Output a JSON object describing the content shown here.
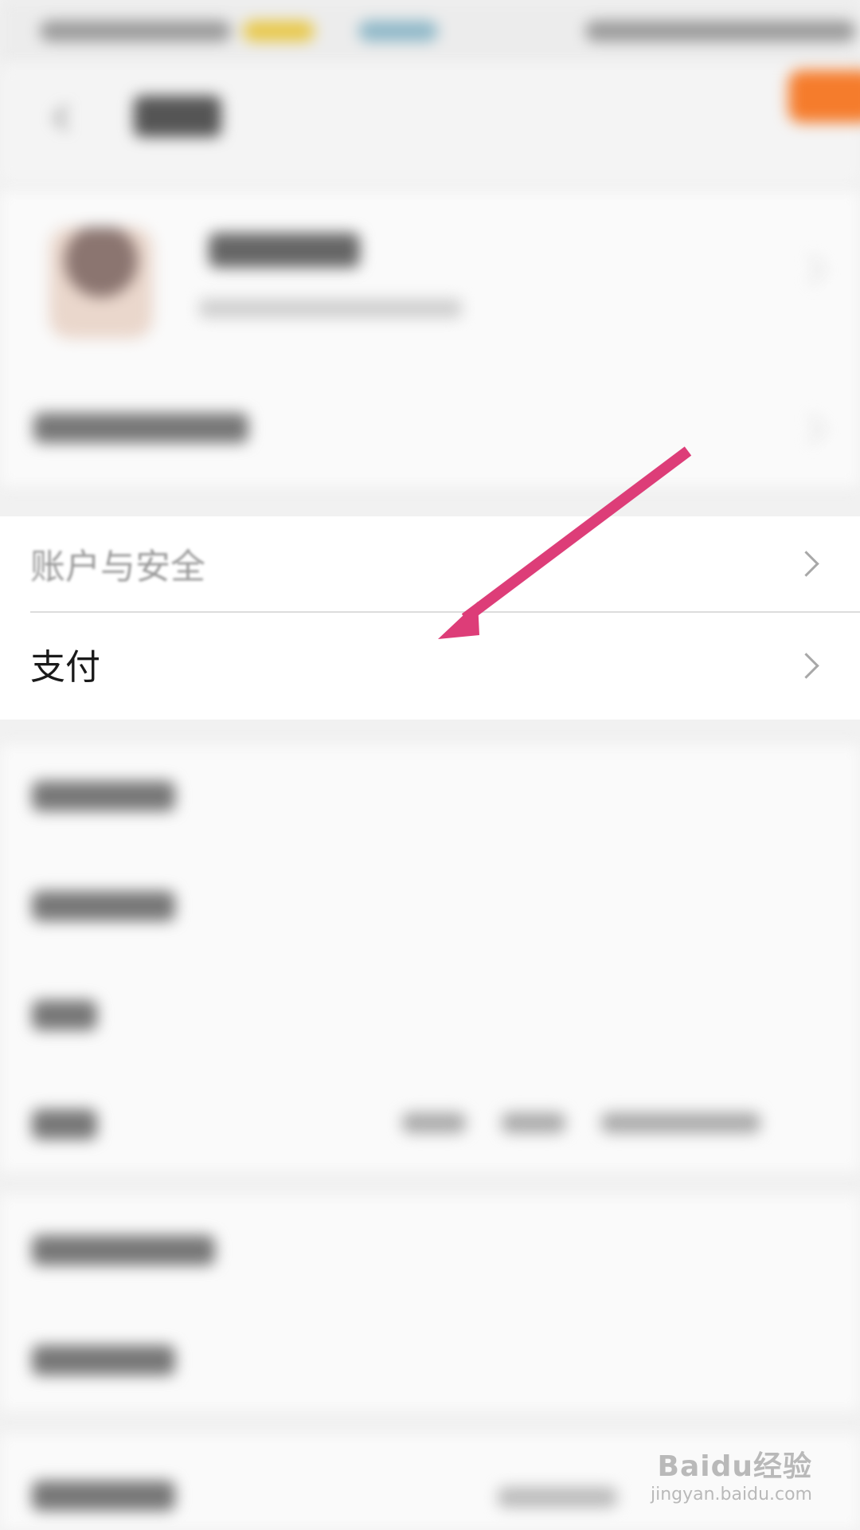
{
  "settings_rows": {
    "account_security_label": "账户与安全",
    "payment_label": "支付"
  },
  "annotation": {
    "arrow_color": "#dd3d78"
  },
  "watermark": {
    "brand": "Baidu经验",
    "domain": "jingyan.baidu.com"
  },
  "colors": {
    "accent_orange": "#f57c2c",
    "background": "#f1f1f1"
  }
}
